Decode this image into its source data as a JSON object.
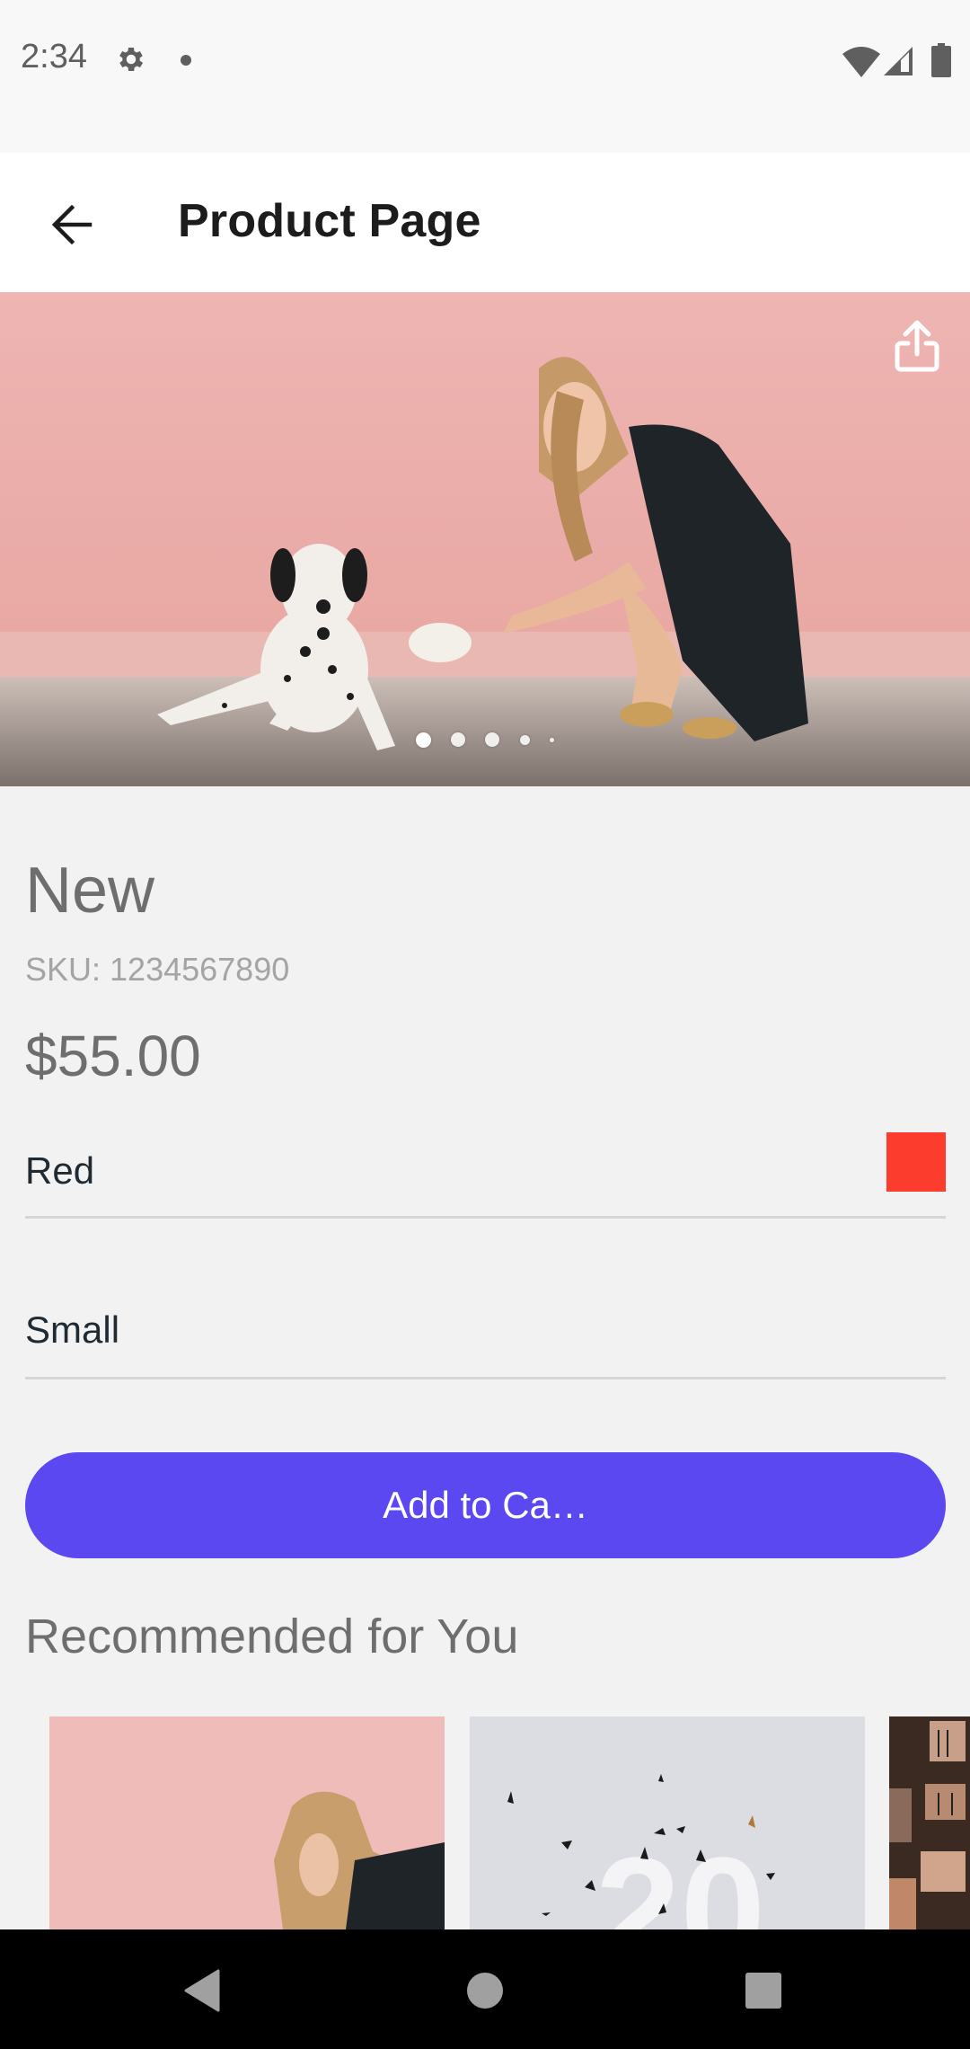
{
  "status_bar": {
    "time": "2:34",
    "icons": [
      "gear-icon",
      "notification-dot",
      "wifi-icon",
      "signal-icon",
      "battery-icon"
    ]
  },
  "app_bar": {
    "back_icon": "arrow-left-icon",
    "title": "Product Page"
  },
  "hero": {
    "image_description": "Woman in polka-dot dress crouching with a Dalmatian puppy against a pink wall",
    "share_icon": "share-icon",
    "carousel": {
      "total_dots_visible": 5,
      "active_index": 0
    }
  },
  "product": {
    "name": "New",
    "sku": "SKU: 1234567890",
    "price": "$55.00",
    "color_option": {
      "label": "Red",
      "swatch_color": "#fc3d2e"
    },
    "size_option": {
      "label": "Small"
    },
    "add_to_cart_label": "Add to Ca…",
    "accent_color": "#5b48f0"
  },
  "recommended": {
    "title": "Recommended for You",
    "items": [
      {
        "image_description": "Woman with long hair against pink wall"
      },
      {
        "image_description": "Confetti falling around white number 20 on grey background"
      },
      {
        "image_description": "Apartment building facade with balconies"
      }
    ]
  },
  "nav_bar": {
    "buttons": [
      "back-triangle-icon",
      "home-circle-icon",
      "recents-square-icon"
    ]
  }
}
